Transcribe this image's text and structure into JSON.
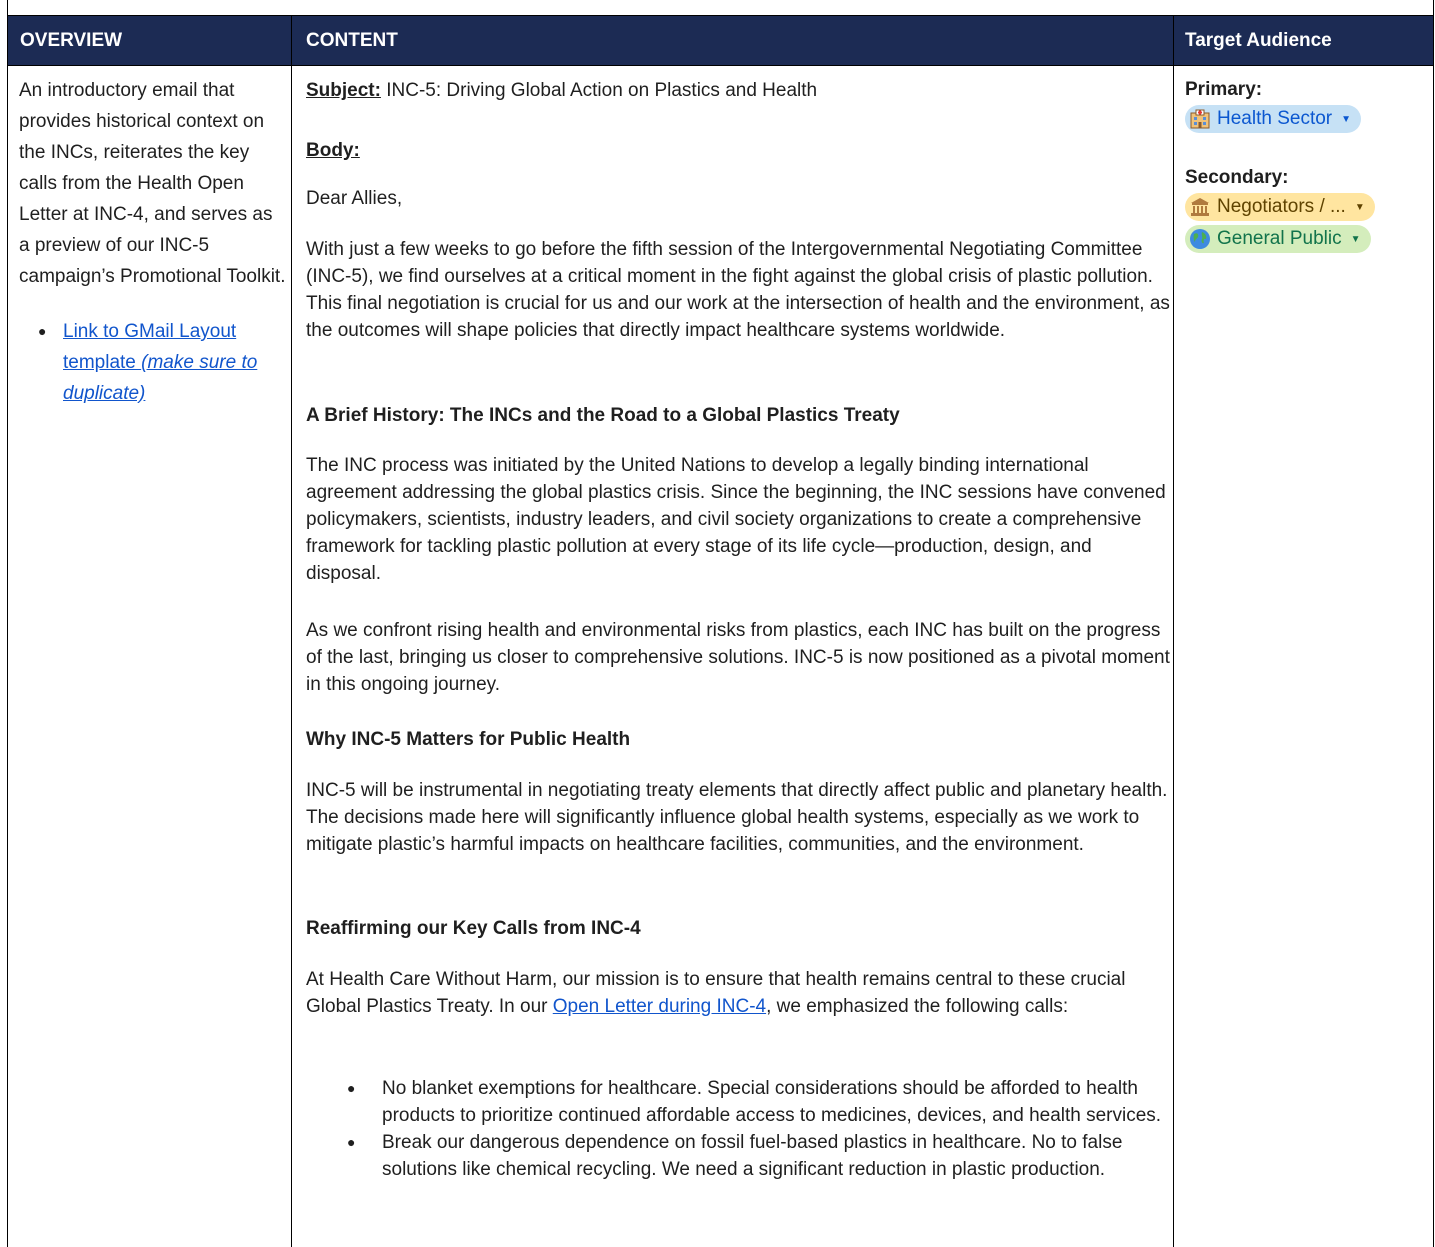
{
  "header": {
    "overview": "OVERVIEW",
    "content": "CONTENT",
    "audience": "Target Audience"
  },
  "overview": {
    "text": "An introductory email that provides historical context on the INCs, reiterates the key calls from the Health Open Letter at INC-4, and serves as a preview of our INC-5 campaign’s Promotional Toolkit.",
    "link_text": "Link to GMail Layout template ",
    "link_note": "(make sure to duplicate)"
  },
  "content": {
    "subject_label": "Subject:",
    "subject": " INC-5: Driving Global Action on Plastics and Health",
    "body_label": "Body:",
    "greeting": "Dear Allies,",
    "p1": "With just a few weeks to go before the fifth session of the Intergovernmental Negotiating Committee (INC-5), we find ourselves at a critical moment in the fight against the global crisis of plastic pollution. This final negotiation is crucial for us and our work at the intersection of health and the environment, as the outcomes will shape policies that directly impact healthcare systems worldwide.",
    "h1": "A Brief History: The INCs and the Road to a Global Plastics Treaty",
    "p2": "The INC process was initiated by the United Nations to develop a legally binding international agreement addressing the global plastics crisis. Since the beginning, the INC sessions have convened policymakers, scientists, industry leaders, and civil society organizations to create a comprehensive framework for tackling plastic pollution at every stage of its life cycle—production, design, and disposal.",
    "p3": "As we confront rising health and environmental risks from plastics, each INC has built on the progress of the last, bringing us closer to comprehensive solutions. INC-5 is now positioned as a pivotal moment in this ongoing journey.",
    "h2": "Why INC-5 Matters for Public Health",
    "p4": "INC-5 will be instrumental in negotiating treaty elements that directly affect public and planetary health. The decisions made here will significantly influence global health systems, especially as we work to mitigate plastic’s harmful impacts on healthcare facilities, communities, and the environment.",
    "h3": "Reaffirming our Key Calls from INC-4",
    "p5_before": "At Health Care Without Harm, our mission is to ensure that health remains central to these crucial Global Plastics Treaty. In our ",
    "p5_link": "Open Letter during INC-4",
    "p5_after": ", we emphasized the following calls:",
    "bullets": [
      "No blanket exemptions for healthcare. Special considerations should be afforded to health products to prioritize continued affordable access to medicines, devices, and health services.",
      "Break our dangerous dependence on fossil fuel-based plastics in healthcare. No to false solutions like chemical recycling. We need a significant reduction in plastic production."
    ]
  },
  "audience": {
    "primary_label": "Primary:",
    "primary_chip": "Health Sector",
    "secondary_label": "Secondary:",
    "secondary_chips": [
      "Negotiators / ...",
      "General Public"
    ],
    "chip_icons": [
      "hospital-icon",
      "classical-building-icon",
      "globe-icon"
    ]
  }
}
